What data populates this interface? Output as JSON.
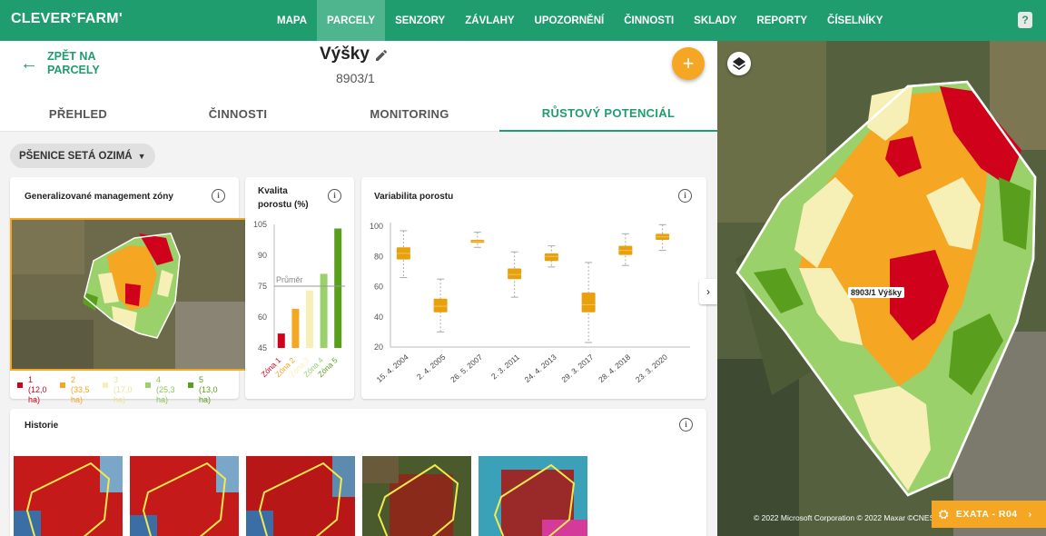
{
  "app": {
    "logo": "CLEVER°FARM'"
  },
  "nav": {
    "items": [
      {
        "label": "MAPA"
      },
      {
        "label": "PARCELY",
        "active": true
      },
      {
        "label": "SENZORY"
      },
      {
        "label": "ZÁVLAHY"
      },
      {
        "label": "UPOZORNĚNÍ"
      },
      {
        "label": "ČINNOSTI"
      },
      {
        "label": "SKLADY"
      },
      {
        "label": "REPORTY"
      },
      {
        "label": "ČÍSELNÍKY"
      }
    ],
    "help_icon": "?"
  },
  "header": {
    "back_label": "ZPĚT NA PARCELY",
    "title": "Výšky",
    "subtitle": "8903/1",
    "fab_label": "+"
  },
  "tabs": [
    {
      "label": "PŘEHLED"
    },
    {
      "label": "ČINNOSTI"
    },
    {
      "label": "MONITORING"
    },
    {
      "label": "RŮSTOVÝ POTENCIÁL",
      "active": true
    }
  ],
  "crop_selector": {
    "value": "PŠENICE SETÁ OZIMÁ"
  },
  "management_zones": {
    "title": "Generalizované management zóny",
    "info": "i",
    "legend": [
      {
        "zone": "1",
        "area": "(12,0",
        "unit": "ha)",
        "color": "#d0021b"
      },
      {
        "zone": "2",
        "area": "(33,5",
        "unit": "ha)",
        "color": "#f5a623"
      },
      {
        "zone": "3",
        "area": "(17,0",
        "unit": "ha)",
        "color": "#f7f0b6"
      },
      {
        "zone": "4",
        "area": "(25,3",
        "unit": "ha)",
        "color": "#9bd16a"
      },
      {
        "zone": "5",
        "area": "(13,0",
        "unit": "ha)",
        "color": "#5a9e1e"
      }
    ]
  },
  "quality": {
    "title": "Kvalita porostu (%)",
    "info": "i",
    "avg_label": "Průměr"
  },
  "variability": {
    "title": "Variabilita porostu",
    "info": "i"
  },
  "history": {
    "title": "Historie",
    "info": "i"
  },
  "map": {
    "parcel_label": "8903/1 Výšky",
    "copyright": "© 2022 Microsoft Corporation © 2022 Maxar ©CNES",
    "exata_label": "EXATA - R04"
  },
  "chart_data": [
    {
      "type": "bar",
      "title": "Kvalita porostu (%)",
      "categories": [
        "Zóna 1",
        "Zóna 2",
        "Zóna 3",
        "Zóna 4",
        "Zóna 5"
      ],
      "values": [
        52,
        64,
        73,
        81,
        103
      ],
      "colors": [
        "#d0021b",
        "#f5a623",
        "#f7f0b6",
        "#9bd16a",
        "#5a9e1e"
      ],
      "yticks": [
        45,
        60,
        75,
        90,
        105
      ],
      "ylim": [
        45,
        105
      ],
      "average": 75,
      "average_label": "Průměr"
    },
    {
      "type": "boxplot",
      "title": "Variabilita porostu",
      "categories": [
        "15. 4. 2004",
        "2. 4. 2005",
        "26. 5. 2007",
        "2. 3. 2011",
        "24. 4. 2013",
        "29. 3. 2017",
        "28. 4. 2018",
        "23. 3. 2020"
      ],
      "yticks": [
        20,
        40,
        60,
        80,
        100
      ],
      "ylim": [
        20,
        100
      ],
      "series": [
        {
          "min": 66,
          "q1": 78,
          "median": 82,
          "q3": 86,
          "max": 97
        },
        {
          "min": 30,
          "q1": 43,
          "median": 47,
          "q3": 52,
          "max": 65
        },
        {
          "min": 86,
          "q1": 89,
          "median": 90,
          "q3": 91,
          "max": 96
        },
        {
          "min": 53,
          "q1": 65,
          "median": 68,
          "q3": 72,
          "max": 83
        },
        {
          "min": 73,
          "q1": 77,
          "median": 80,
          "q3": 82,
          "max": 87
        },
        {
          "min": 23,
          "q1": 43,
          "median": 48,
          "q3": 56,
          "max": 76
        },
        {
          "min": 74,
          "q1": 81,
          "median": 84,
          "q3": 87,
          "max": 95
        },
        {
          "min": 84,
          "q1": 91,
          "median": 93,
          "q3": 95,
          "max": 101
        }
      ]
    }
  ]
}
